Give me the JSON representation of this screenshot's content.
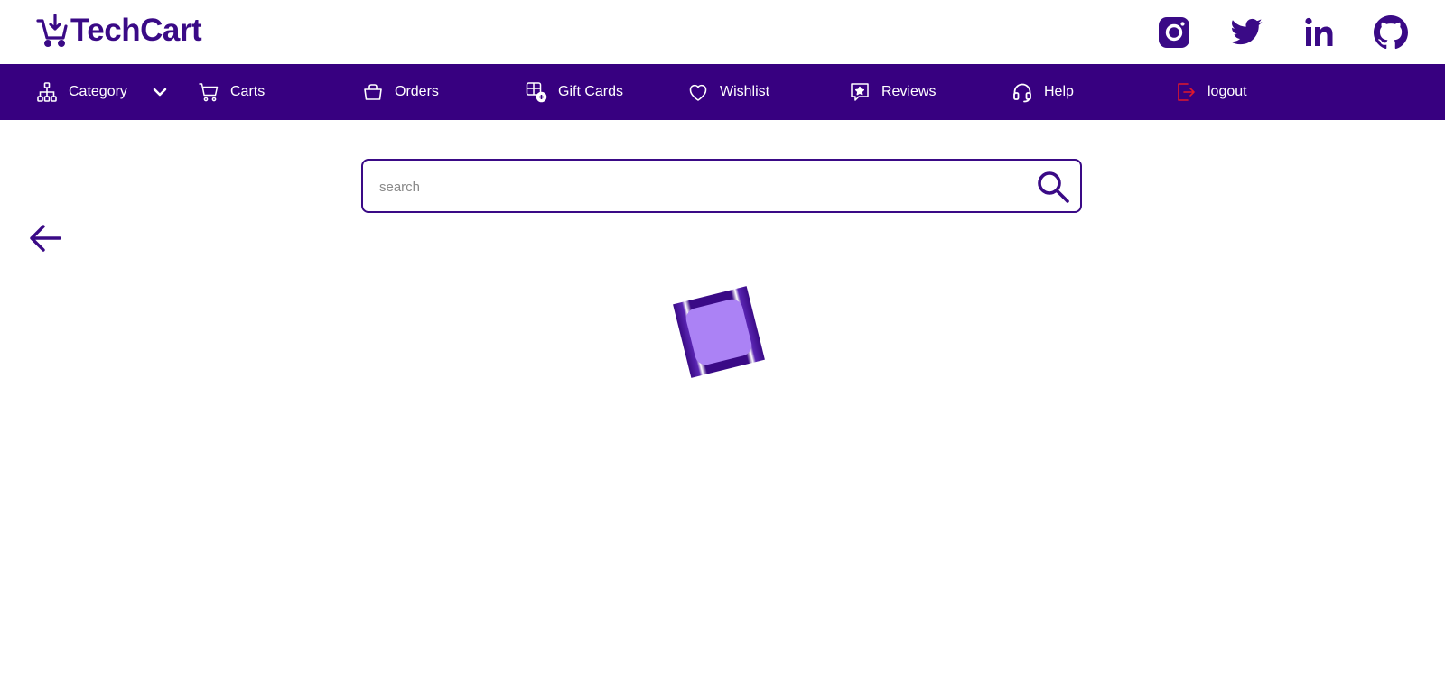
{
  "brand": {
    "name": "TechCart",
    "icon": "cart-download-icon"
  },
  "social": [
    {
      "name": "instagram-icon"
    },
    {
      "name": "twitter-icon"
    },
    {
      "name": "linkedin-icon"
    },
    {
      "name": "github-icon"
    }
  ],
  "nav": {
    "category": "Category",
    "carts": "Carts",
    "orders": "Orders",
    "gift_cards": "Gift Cards",
    "wishlist": "Wishlist",
    "reviews": "Reviews",
    "help": "Help",
    "logout": "logout"
  },
  "search": {
    "placeholder": "search",
    "value": ""
  },
  "colors": {
    "brand": "#3a0a86",
    "navbar": "#370080",
    "logout_icon": "#e0182b",
    "loader_fill": "#ab82f5"
  }
}
